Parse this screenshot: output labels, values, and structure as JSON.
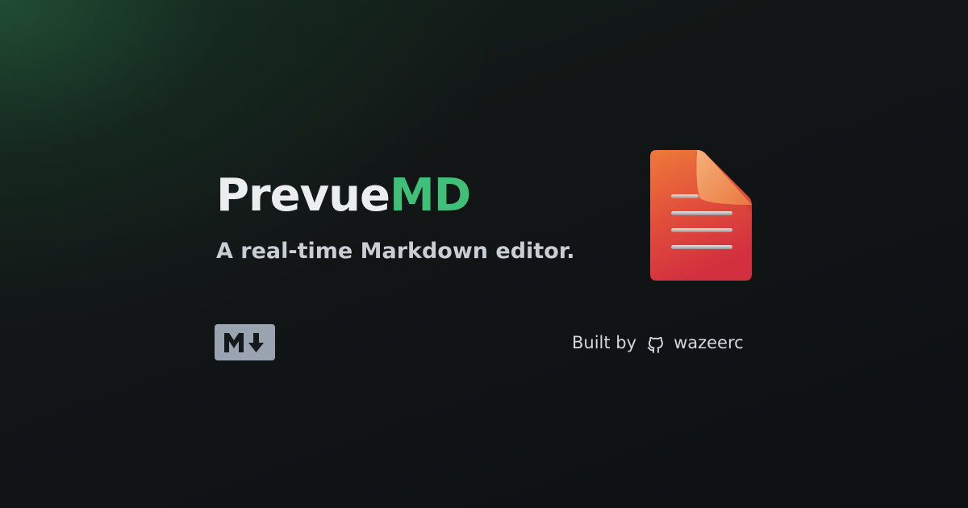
{
  "title": {
    "part1": "Prevue",
    "part2": "MD",
    "part1_color": "#ecedee",
    "part2_color": "#3fbf77"
  },
  "subtitle": "A real-time Markdown editor.",
  "badge": {
    "icon": "markdown-icon",
    "color": "#9aa3b0"
  },
  "credit": {
    "prefix": "Built by",
    "icon": "github-icon",
    "author": "wazeerc"
  },
  "document_icon": {
    "icon": "document-icon",
    "gradient_top": "#ee7a3a",
    "gradient_bottom": "#d3303f"
  },
  "background_color": "#101315",
  "glow_color": "#2a6e46"
}
